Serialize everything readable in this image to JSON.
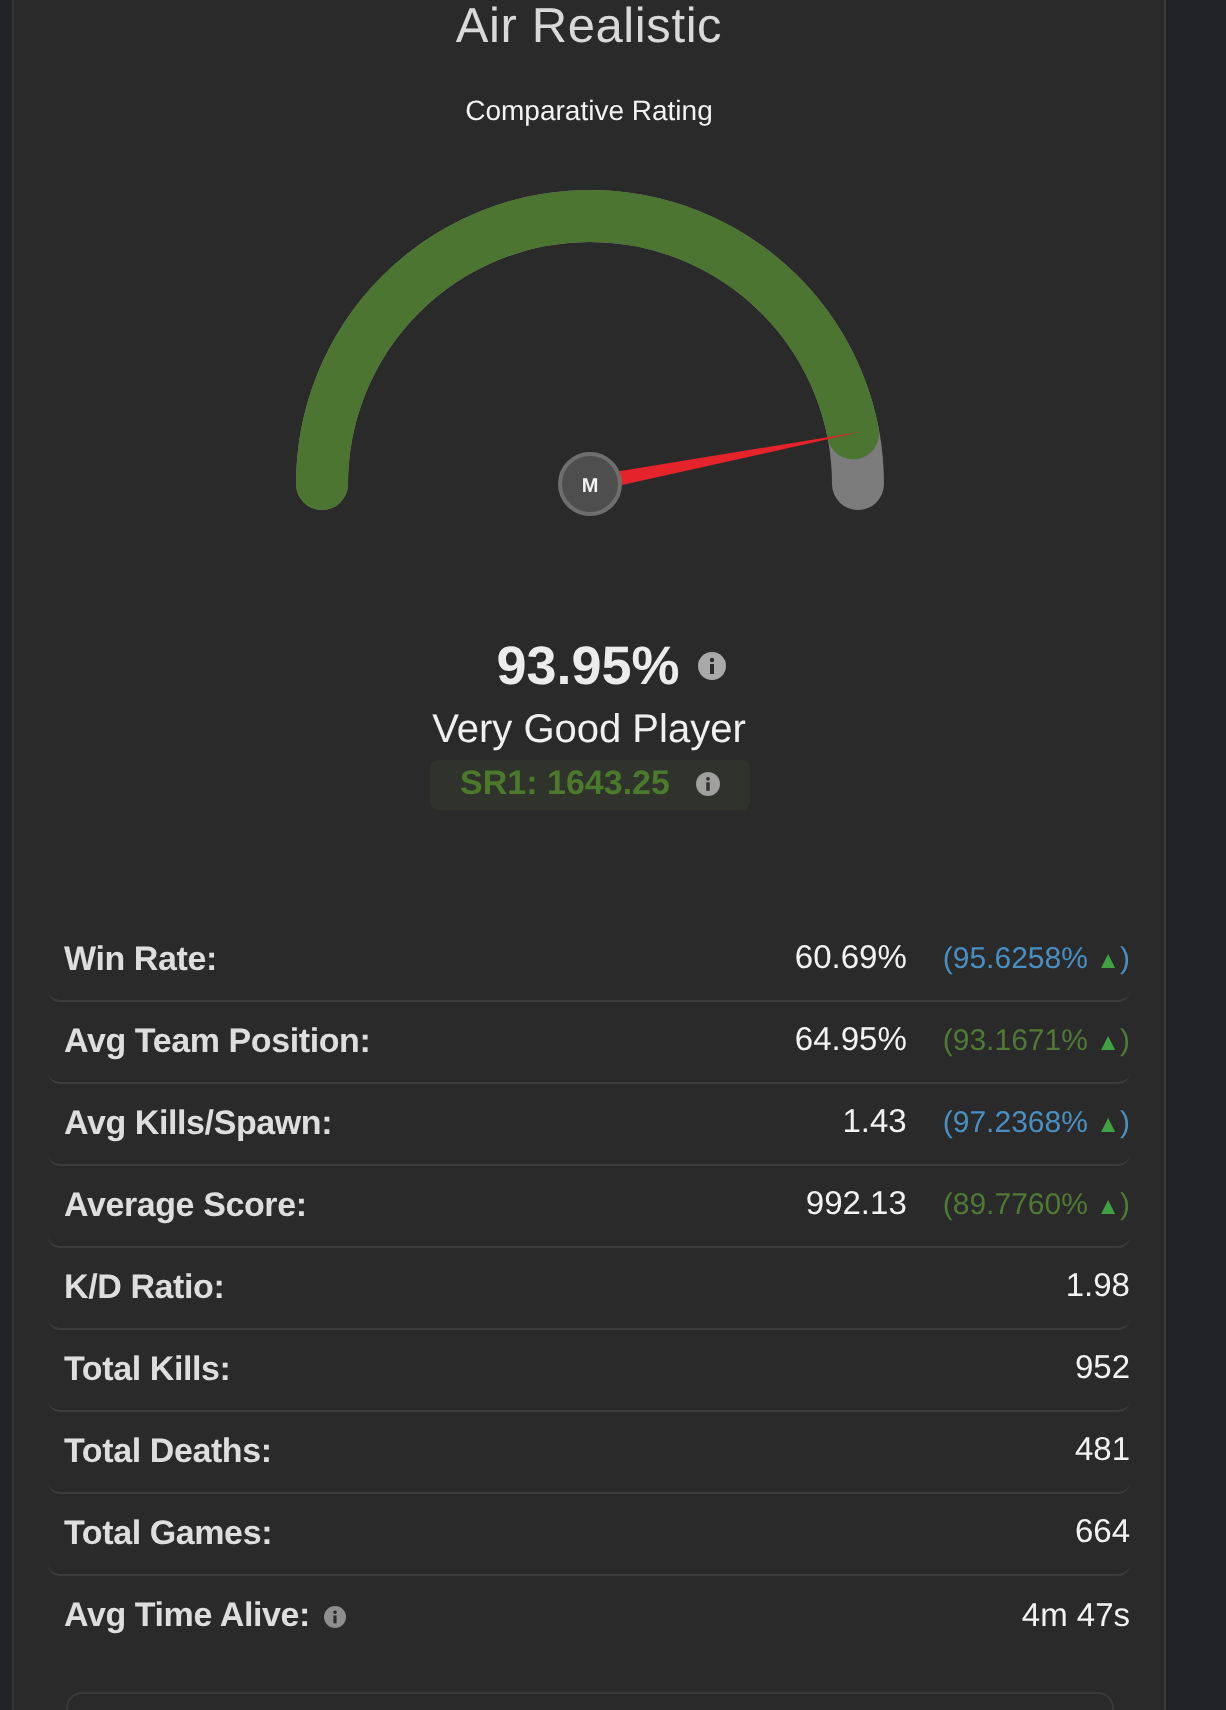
{
  "title": "Air Realistic",
  "subtitle": "Comparative Rating",
  "gauge": {
    "level": 0.9395,
    "hub_label": "M"
  },
  "rating": {
    "value": "93.95%",
    "label": "Very Good Player",
    "sr": "SR1: 1643.25"
  },
  "stats": [
    {
      "label": "Win Rate:",
      "info": false,
      "value": "60.69%",
      "percentile": {
        "text": "(95.6258%",
        "arrow": "▲",
        "close": ")",
        "color": "#4a8fc2"
      }
    },
    {
      "label": "Avg Team Position:",
      "info": false,
      "value": "64.95%",
      "percentile": {
        "text": "(93.1671%",
        "arrow": "▲",
        "close": ")",
        "color": "#4f7a35"
      }
    },
    {
      "label": "Avg Kills/Spawn:",
      "info": false,
      "value": "1.43",
      "percentile": {
        "text": "(97.2368%",
        "arrow": "▲",
        "close": ")",
        "color": "#4a8fc2"
      }
    },
    {
      "label": "Average Score:",
      "info": false,
      "value": "992.13",
      "percentile": {
        "text": "(89.7760%",
        "arrow": "▲",
        "close": ")",
        "color": "#4f7a35"
      }
    },
    {
      "label": "K/D Ratio:",
      "info": false,
      "value": "1.98"
    },
    {
      "label": "Total Kills:",
      "info": false,
      "value": "952"
    },
    {
      "label": "Total Deaths:",
      "info": false,
      "value": "481"
    },
    {
      "label": "Total Games:",
      "info": false,
      "value": "664"
    },
    {
      "label": "Avg Time Alive:",
      "info": true,
      "value": "4m 47s"
    }
  ]
}
